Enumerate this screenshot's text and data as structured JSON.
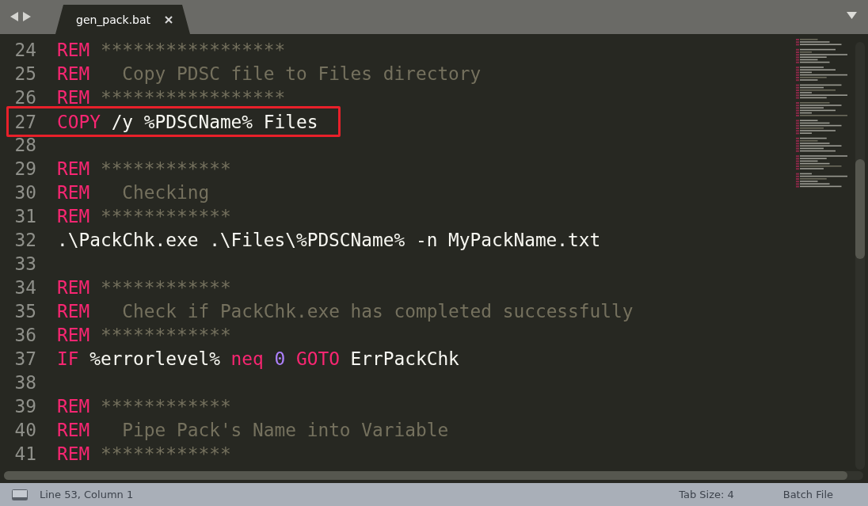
{
  "tabs": [
    {
      "label": "gen_pack.bat",
      "selected": true
    }
  ],
  "lines": [
    {
      "number": "24",
      "tokens": [
        {
          "kind": "keyword",
          "text": "REM"
        },
        {
          "kind": "comment",
          "text": " *****************"
        }
      ]
    },
    {
      "number": "25",
      "tokens": [
        {
          "kind": "keyword",
          "text": "REM"
        },
        {
          "kind": "comment",
          "text": "   Copy PDSC file to Files directory"
        }
      ]
    },
    {
      "number": "26",
      "tokens": [
        {
          "kind": "keyword",
          "text": "REM"
        },
        {
          "kind": "comment",
          "text": " *****************"
        }
      ]
    },
    {
      "number": "27",
      "highlighted": true,
      "tokens": [
        {
          "kind": "keyword",
          "text": "COPY"
        },
        {
          "kind": "plain",
          "text": " /y %PDSCName% Files"
        }
      ]
    },
    {
      "number": "28"
    },
    {
      "number": "29",
      "tokens": [
        {
          "kind": "keyword",
          "text": "REM"
        },
        {
          "kind": "comment",
          "text": " ************"
        }
      ]
    },
    {
      "number": "30",
      "tokens": [
        {
          "kind": "keyword",
          "text": "REM"
        },
        {
          "kind": "comment",
          "text": "   Checking"
        }
      ]
    },
    {
      "number": "31",
      "tokens": [
        {
          "kind": "keyword",
          "text": "REM"
        },
        {
          "kind": "comment",
          "text": " ************"
        }
      ]
    },
    {
      "number": "32",
      "tokens": [
        {
          "kind": "plain",
          "text": ".\\PackChk.exe .\\Files\\%PDSCName% -n MyPackName.txt"
        }
      ]
    },
    {
      "number": "33"
    },
    {
      "number": "34",
      "tokens": [
        {
          "kind": "keyword",
          "text": "REM"
        },
        {
          "kind": "comment",
          "text": " ************"
        }
      ]
    },
    {
      "number": "35",
      "tokens": [
        {
          "kind": "keyword",
          "text": "REM"
        },
        {
          "kind": "comment",
          "text": "   Check if PackChk.exe has completed successfully"
        }
      ]
    },
    {
      "number": "36",
      "tokens": [
        {
          "kind": "keyword",
          "text": "REM"
        },
        {
          "kind": "comment",
          "text": " ************"
        }
      ]
    },
    {
      "number": "37",
      "tokens": [
        {
          "kind": "keyword",
          "text": "IF"
        },
        {
          "kind": "plain",
          "text": " %errorlevel% "
        },
        {
          "kind": "keyword",
          "text": "neq"
        },
        {
          "kind": "number",
          "text": " 0"
        },
        {
          "kind": "keyword",
          "text": " GOTO"
        },
        {
          "kind": "plain",
          "text": " ErrPackChk"
        }
      ]
    },
    {
      "number": "38"
    },
    {
      "number": "39",
      "tokens": [
        {
          "kind": "keyword",
          "text": "REM"
        },
        {
          "kind": "comment",
          "text": " ************"
        }
      ]
    },
    {
      "number": "40",
      "tokens": [
        {
          "kind": "keyword",
          "text": "REM"
        },
        {
          "kind": "comment",
          "text": "   Pipe Pack's Name into Variable"
        }
      ]
    },
    {
      "number": "41",
      "tokens": [
        {
          "kind": "keyword",
          "text": "REM"
        },
        {
          "kind": "comment",
          "text": " ************"
        }
      ]
    }
  ],
  "status_bar": {
    "position": "Line 53, Column 1",
    "tab_size": "Tab Size: 4",
    "syntax": "Batch File"
  }
}
